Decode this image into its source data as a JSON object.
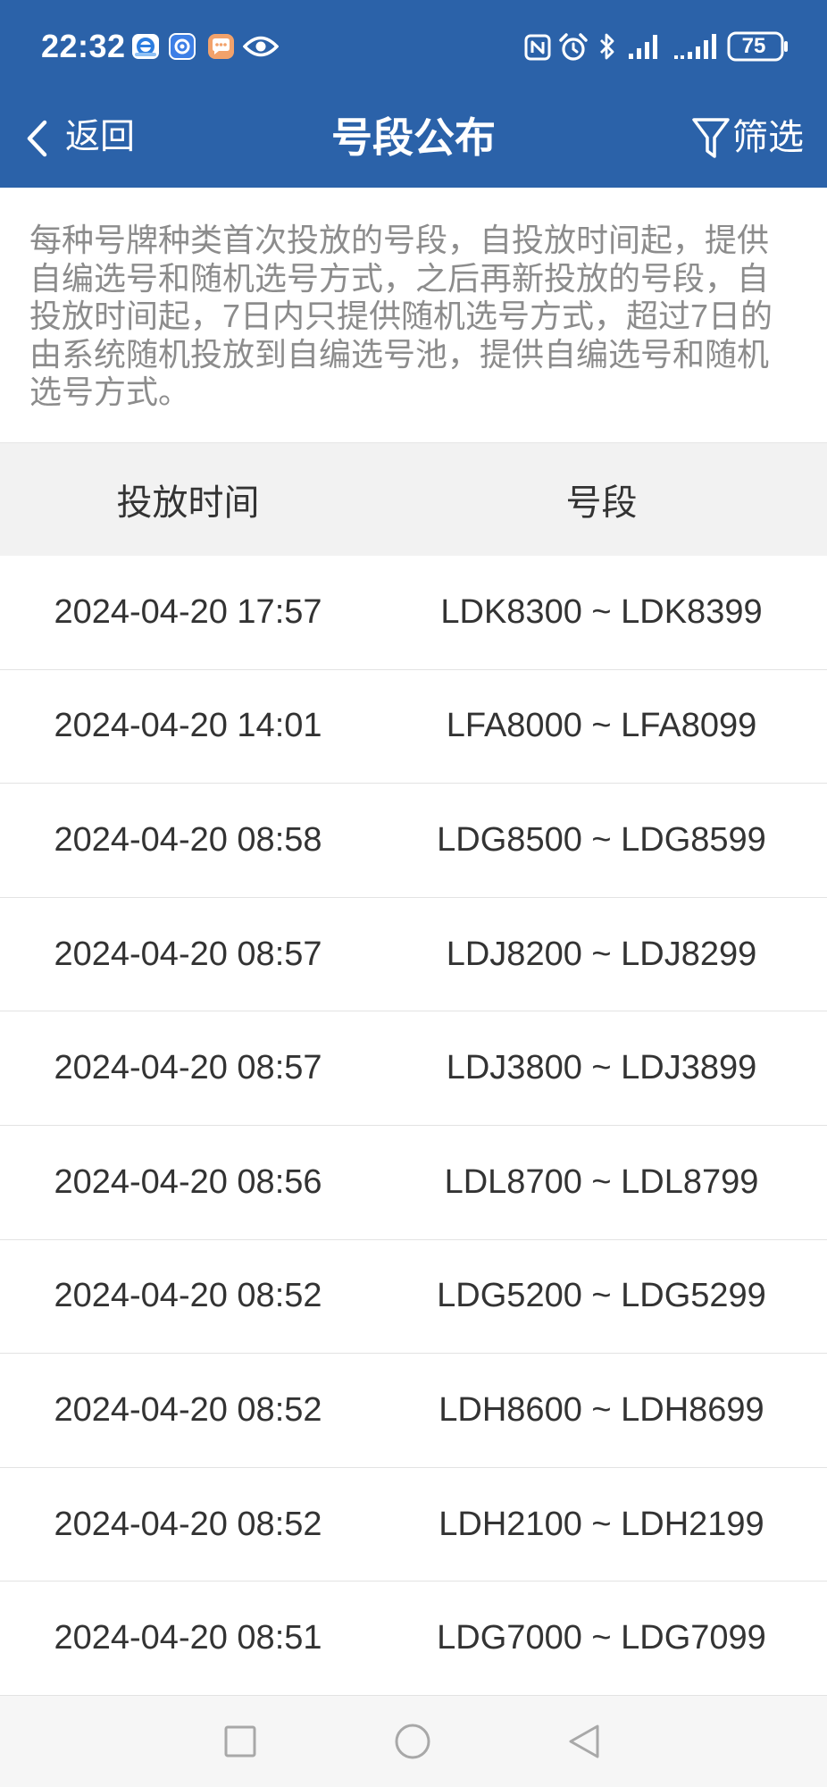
{
  "status_bar": {
    "time": "22:32",
    "battery": "75",
    "left_icons": [
      "app-notification-icon",
      "app-badge-icon",
      "message-bubble-icon",
      "eye-icon"
    ],
    "right_icons": [
      "nfc-icon",
      "alarm-clock-icon",
      "bluetooth-icon",
      "signal-strength-icon",
      "signal-strength-icon",
      "battery-icon"
    ]
  },
  "header": {
    "back_label": "返回",
    "back_icon": "chevron-left-icon",
    "title": "号段公布",
    "filter_label": "筛选",
    "filter_icon": "funnel-icon"
  },
  "notice": "每种号牌种类首次投放的号段，自投放时间起，提供自编选号和随机选号方式，之后再新投放的号段，自投放时间起，7日内只提供随机选号方式，超过7日的由系统随机投放到自编选号池，提供自编选号和随机选号方式。",
  "table": {
    "columns": [
      "投放时间",
      "号段"
    ],
    "rows": [
      {
        "time": "2024-04-20 17:57",
        "range": "LDK8300 ~ LDK8399"
      },
      {
        "time": "2024-04-20 14:01",
        "range": "LFA8000 ~ LFA8099"
      },
      {
        "time": "2024-04-20 08:58",
        "range": "LDG8500 ~ LDG8599"
      },
      {
        "time": "2024-04-20 08:57",
        "range": "LDJ8200 ~ LDJ8299"
      },
      {
        "time": "2024-04-20 08:57",
        "range": "LDJ3800 ~ LDJ3899"
      },
      {
        "time": "2024-04-20 08:56",
        "range": "LDL8700 ~ LDL8799"
      },
      {
        "time": "2024-04-20 08:52",
        "range": "LDG5200 ~ LDG5299"
      },
      {
        "time": "2024-04-20 08:52",
        "range": "LDH8600 ~ LDH8699"
      },
      {
        "time": "2024-04-20 08:52",
        "range": "LDH2100 ~ LDH2199"
      },
      {
        "time": "2024-04-20 08:51",
        "range": "LDG7000 ~ LDG7099"
      }
    ]
  },
  "nav_bar": {
    "icons": [
      "recent-apps-square-icon",
      "home-circle-icon",
      "back-triangle-icon"
    ]
  },
  "colors": {
    "header_bg": "#2b62a9",
    "table_header_bg": "#f2f2f2",
    "text": "#333333",
    "muted_text": "#8c8c8c",
    "nav_bg": "#f6f6f6"
  }
}
